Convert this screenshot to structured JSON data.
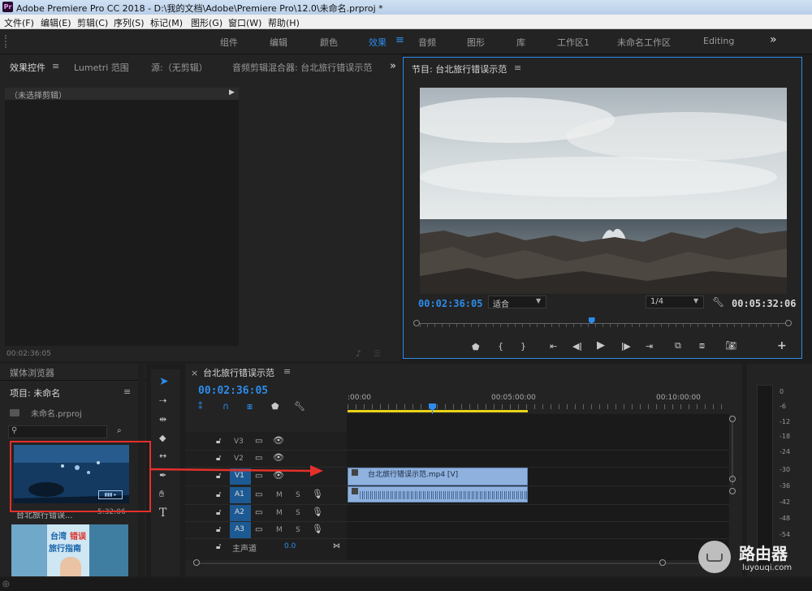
{
  "window": {
    "title": "Adobe Premiere Pro CC 2018 - D:\\我的文档\\Adobe\\Premiere Pro\\12.0\\未命名.prproj *",
    "app_icon": "Pr"
  },
  "menu": [
    "文件(F)",
    "编辑(E)",
    "剪辑(C)",
    "序列(S)",
    "标记(M)",
    "图形(G)",
    "窗口(W)",
    "帮助(H)"
  ],
  "workspaces": [
    "组件",
    "编辑",
    "颜色",
    "效果",
    "音频",
    "图形",
    "库",
    "工作区1",
    "未命名工作区",
    "Editing"
  ],
  "workspace_active": "效果",
  "workspace_more": "»",
  "top_left_panel": {
    "tabs": [
      "效果控件",
      "Lumetri 范围",
      "源:（无剪辑）",
      "音频剪辑混合器: 台北旅行错误示范"
    ],
    "active_tab": "效果控件",
    "no_clip": "（未选择剪辑）",
    "timecode": "00:02:36:05",
    "more": "»"
  },
  "program_monitor": {
    "title": "节目: 台北旅行错误示范",
    "timecode": "00:02:36:05",
    "fit": "适合",
    "resolution": "1/4",
    "duration": "00:05:32:06",
    "playhead_fraction": 0.47
  },
  "project_panel": {
    "tab_media": "媒体浏览器",
    "title": "项目: 未命名",
    "file": "未命名.prproj",
    "clip_name": "台北旅行错误...",
    "clip_duration": "5:32:06",
    "thumb2_line1a": "台湾",
    "thumb2_line1b": "错误",
    "thumb2_line2": "旅行指南"
  },
  "timeline": {
    "title": "台北旅行错误示范",
    "timecode": "00:02:36:05",
    "ruler": [
      ":00:00",
      "00:05:00:00",
      "00:10:00:00"
    ],
    "tracks_video": [
      "V3",
      "V2",
      "V1"
    ],
    "tracks_audio": [
      "A1",
      "A2",
      "A3"
    ],
    "master": "主声道",
    "master_value": "0.0",
    "mute": "M",
    "solo": "S",
    "clip_label": "台北旅行错误示范.mp4 [V]"
  },
  "meter_ticks": [
    "0",
    "-6",
    "-12",
    "-18",
    "-24",
    "-30",
    "-36",
    "-42",
    "-48",
    "-54"
  ],
  "watermark": {
    "text": "路由器",
    "url": "luyouqi.com"
  },
  "colors": {
    "accent": "#2d8ceb",
    "clip": "#8fb1de",
    "annotation": "#e4302a",
    "work_bar": "#e7d21a"
  }
}
